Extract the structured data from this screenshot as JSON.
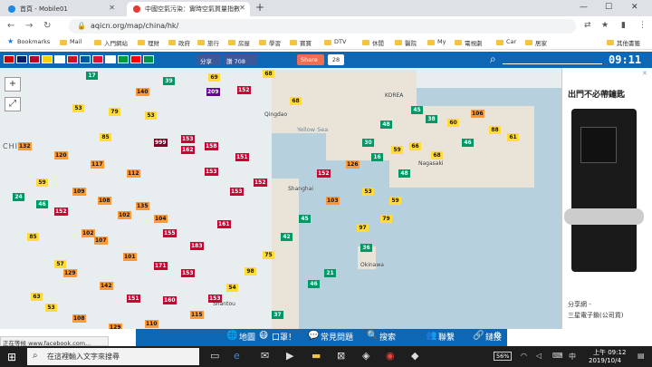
{
  "browser": {
    "tabs": [
      {
        "title": "首頁 - Mobile01",
        "active": false
      },
      {
        "title": "中國空氣污染：實時空氣質量指數",
        "active": true
      }
    ],
    "new_tab": "+",
    "url": "aqicn.org/map/china/hk/",
    "window_controls": [
      "—",
      "☐",
      "✕"
    ]
  },
  "bookmarks": [
    {
      "label": "Bookmarks",
      "star": true
    },
    {
      "label": "Mail"
    },
    {
      "label": "入門網站"
    },
    {
      "label": "理財"
    },
    {
      "label": "政府"
    },
    {
      "label": "旅行"
    },
    {
      "label": "房屋"
    },
    {
      "label": "學習"
    },
    {
      "label": "寶寶"
    },
    {
      "label": "DTV"
    },
    {
      "label": "休閒"
    },
    {
      "label": "醫院"
    },
    {
      "label": "My"
    },
    {
      "label": "電視劇"
    },
    {
      "label": "Car"
    },
    {
      "label": "居家"
    },
    {
      "label": "其他書籤"
    }
  ],
  "toolbar": {
    "fb_share": "分享",
    "fb_like": "讚 708",
    "share_label": "Share",
    "share_count": "28",
    "clock": "09:11"
  },
  "flags": [
    "#cc0000",
    "#012169",
    "#bc002d",
    "#ffce00",
    "#ffffff",
    "#ce1126",
    "#0055a4",
    "#dc143c",
    "#ffffff",
    "#009c3b",
    "#ff0000",
    "#009246"
  ],
  "map": {
    "country_label": "CHINA",
    "sea_label": "Yellow Sea",
    "cities": [
      {
        "name": "Qingdao"
      },
      {
        "name": "Shanghai"
      },
      {
        "name": "Shantou"
      },
      {
        "name": "KOREA"
      },
      {
        "name": "Nagasaki"
      },
      {
        "name": "Okinawa"
      }
    ],
    "zoom_in": "+",
    "zoom_out": "−",
    "markers": [
      {
        "v": "17",
        "c": "g"
      },
      {
        "v": "39",
        "c": "g"
      },
      {
        "v": "69",
        "c": "y"
      },
      {
        "v": "68",
        "c": "y"
      },
      {
        "v": "209",
        "c": "p"
      },
      {
        "v": "152",
        "c": "r"
      },
      {
        "v": "53",
        "c": "y"
      },
      {
        "v": "79",
        "c": "y"
      },
      {
        "v": "53",
        "c": "y"
      },
      {
        "v": "68",
        "c": "y"
      },
      {
        "v": "153",
        "c": "r"
      },
      {
        "v": "158",
        "c": "r"
      },
      {
        "v": "999",
        "c": "dp"
      },
      {
        "v": "162",
        "c": "r"
      },
      {
        "v": "151",
        "c": "r"
      },
      {
        "v": "153",
        "c": "r"
      },
      {
        "v": "152",
        "c": "r"
      },
      {
        "v": "153",
        "c": "r"
      },
      {
        "v": "59",
        "c": "y"
      },
      {
        "v": "109",
        "c": "o"
      },
      {
        "v": "108",
        "c": "o"
      },
      {
        "v": "102",
        "c": "o"
      },
      {
        "v": "135",
        "c": "o"
      },
      {
        "v": "104",
        "c": "o"
      },
      {
        "v": "24",
        "c": "g"
      },
      {
        "v": "46",
        "c": "g"
      },
      {
        "v": "152",
        "c": "r"
      },
      {
        "v": "155",
        "c": "r"
      },
      {
        "v": "183",
        "c": "r"
      },
      {
        "v": "161",
        "c": "r"
      },
      {
        "v": "107",
        "c": "o"
      },
      {
        "v": "171",
        "c": "r"
      },
      {
        "v": "153",
        "c": "r"
      },
      {
        "v": "101",
        "c": "o"
      },
      {
        "v": "102",
        "c": "o"
      },
      {
        "v": "57",
        "c": "y"
      },
      {
        "v": "85",
        "c": "y"
      },
      {
        "v": "129",
        "c": "o"
      },
      {
        "v": "142",
        "c": "o"
      },
      {
        "v": "151",
        "c": "r"
      },
      {
        "v": "160",
        "c": "r"
      },
      {
        "v": "115",
        "c": "o"
      },
      {
        "v": "63",
        "c": "y"
      },
      {
        "v": "53",
        "c": "y"
      },
      {
        "v": "108",
        "c": "o"
      },
      {
        "v": "129",
        "c": "o"
      },
      {
        "v": "110",
        "c": "o"
      },
      {
        "v": "37",
        "c": "g"
      },
      {
        "v": "45",
        "c": "g"
      },
      {
        "v": "38",
        "c": "g"
      },
      {
        "v": "60",
        "c": "y"
      },
      {
        "v": "106",
        "c": "o"
      },
      {
        "v": "88",
        "c": "y"
      },
      {
        "v": "61",
        "c": "y"
      },
      {
        "v": "21",
        "c": "g"
      },
      {
        "v": "46",
        "c": "g"
      },
      {
        "v": "59",
        "c": "y"
      },
      {
        "v": "66",
        "c": "y"
      },
      {
        "v": "68",
        "c": "y"
      },
      {
        "v": "46",
        "c": "g"
      },
      {
        "v": "16",
        "c": "g"
      },
      {
        "v": "48",
        "c": "g"
      },
      {
        "v": "53",
        "c": "y"
      },
      {
        "v": "59",
        "c": "y"
      },
      {
        "v": "79",
        "c": "y"
      },
      {
        "v": "97",
        "c": "y"
      },
      {
        "v": "36",
        "c": "g"
      },
      {
        "v": "48",
        "c": "g"
      },
      {
        "v": "30",
        "c": "g"
      },
      {
        "v": "126",
        "c": "o"
      },
      {
        "v": "152",
        "c": "r"
      },
      {
        "v": "103",
        "c": "o"
      },
      {
        "v": "45",
        "c": "g"
      },
      {
        "v": "42",
        "c": "g"
      },
      {
        "v": "75",
        "c": "y"
      },
      {
        "v": "98",
        "c": "y"
      },
      {
        "v": "54",
        "c": "y"
      },
      {
        "v": "153",
        "c": "r"
      },
      {
        "v": "132",
        "c": "o"
      },
      {
        "v": "120",
        "c": "o"
      },
      {
        "v": "117",
        "c": "o"
      },
      {
        "v": "112",
        "c": "o"
      },
      {
        "v": "85",
        "c": "y"
      },
      {
        "v": "140",
        "c": "o"
      }
    ]
  },
  "ad": {
    "title": "出門不必帶鑰匙",
    "caption1": "分享網 -",
    "caption2": "三星電子鎖(公司貨)",
    "close": "✕"
  },
  "bottom_nav": [
    {
      "label": "地圖",
      "icon": "🌐"
    },
    {
      "label": "口罩！",
      "icon": "😷"
    },
    {
      "label": "常見問題",
      "icon": "💬"
    },
    {
      "label": "搜索",
      "icon": "🔍"
    },
    {
      "label": "聯繫",
      "icon": "👥"
    },
    {
      "label": "鏈接",
      "icon": "🔗"
    },
    {
      "label": "",
      "icon": "⚙"
    }
  ],
  "status_url": "正在等候 www.facebook.com...",
  "taskbar": {
    "search_placeholder": "在這裡輸入文字來搜尋",
    "battery": "56%",
    "time_ampm": "上午 09:12",
    "date": "2019/10/4"
  }
}
